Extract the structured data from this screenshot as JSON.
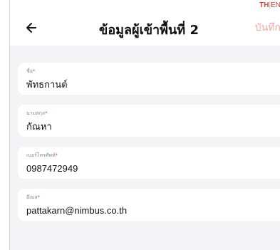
{
  "header": {
    "title": "ข้อมูลผู้เข้าพื้นที่ 2",
    "save_label": "บันทึก",
    "language": {
      "active": "TH",
      "separator": "|",
      "inactive": "EN"
    }
  },
  "form": {
    "fields": [
      {
        "label": "ชื่อ",
        "required_mark": "*",
        "value": "พัทธกานต์"
      },
      {
        "label": "นามสกุล",
        "required_mark": "*",
        "value": "กัณหา"
      },
      {
        "label": "เบอร์โทรศัพท์",
        "required_mark": "*",
        "value": "0987472949"
      },
      {
        "label": "อีเมล",
        "required_mark": "*",
        "value": "pattakarn@nimbus.co.th"
      }
    ]
  },
  "colors": {
    "accent": "#e0433d",
    "save_disabled": "#f1a7a4",
    "background": "#f4f4f6",
    "card": "#ffffff"
  },
  "icons": {
    "back": "arrow-left-icon"
  }
}
